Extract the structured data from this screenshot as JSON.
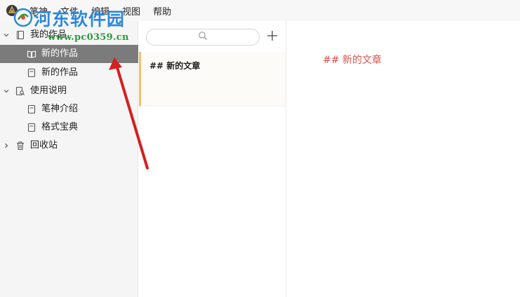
{
  "menubar": {
    "logo_icon": "bishen-app-logo-icon",
    "items": [
      "笔神",
      "文件",
      "编辑",
      "视图",
      "帮助"
    ]
  },
  "watermark": {
    "title": "河东软件园",
    "url": "www.pc0359.cn"
  },
  "sidebar": {
    "tree": [
      {
        "label": "我的作品",
        "icon": "notebook-icon",
        "expanded": true
      },
      {
        "label": "新的作品",
        "icon": "open-book-icon",
        "selected": true
      },
      {
        "label": "新的作品",
        "icon": "document-icon"
      },
      {
        "label": "使用说明",
        "icon": "document-search-icon",
        "expanded": true
      },
      {
        "label": "笔神介绍",
        "icon": "document-icon"
      },
      {
        "label": "格式宝典",
        "icon": "document-icon"
      },
      {
        "label": "回收站",
        "icon": "trash-icon",
        "expanded": false
      }
    ]
  },
  "list": {
    "search_icon": "search-icon",
    "add_icon": "plus-icon",
    "articles": [
      {
        "title": "## 新的文章"
      }
    ]
  },
  "editor": {
    "heading": "## 新的文章"
  },
  "colors": {
    "selected_bg": "#7b7b7b",
    "card_accent": "#f3c06b",
    "heading_red": "#d9534f",
    "watermark_blue": "#2f87d9",
    "watermark_green": "#2b9a3a",
    "arrow_red": "#d42020"
  }
}
